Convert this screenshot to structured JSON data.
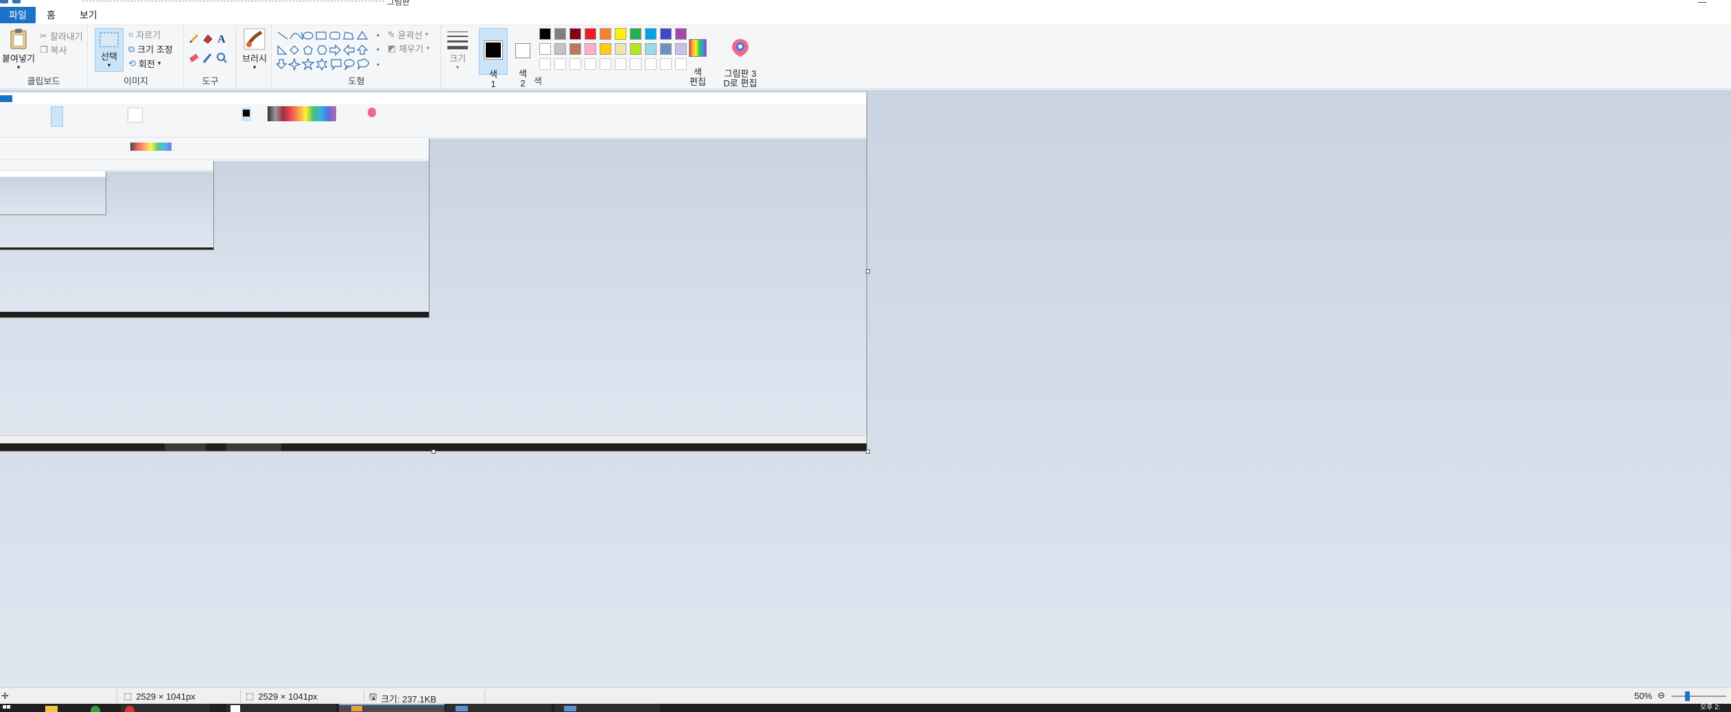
{
  "app": {
    "title": "그림판"
  },
  "menu": {
    "file": "파일",
    "home": "홈",
    "view": "보기"
  },
  "ribbon": {
    "clipboard": {
      "label": "클립보드",
      "paste": "붙여넣기",
      "cut": "잘라내기",
      "copy": "복사"
    },
    "image": {
      "label": "이미지",
      "select": "선택",
      "crop": "자르기",
      "resize": "크기 조정",
      "rotate": "회전"
    },
    "tools": {
      "label": "도구"
    },
    "brush": {
      "label": "브러시"
    },
    "shapes": {
      "label": "도형",
      "outline": "윤곽선",
      "fill": "채우기"
    },
    "size": {
      "label": "크기"
    },
    "colors": {
      "label": "색",
      "color1": "색\n1",
      "color2": "색\n2",
      "edit": "색\n편집",
      "paint3d": "그림판 3\nD로 편집",
      "row1": [
        "#000000",
        "#7f7f7f",
        "#880015",
        "#ed1c24",
        "#ff7f27",
        "#fff200",
        "#22b14c",
        "#00a2e8",
        "#3f48cc",
        "#a349a4"
      ],
      "row2": [
        "#ffffff",
        "#c3c3c3",
        "#b97a57",
        "#ffaec9",
        "#ffc90e",
        "#efe4b0",
        "#b5e61d",
        "#99d9ea",
        "#7092be",
        "#c8bfe7"
      ]
    }
  },
  "statusbar": {
    "selection_size": "2529 × 1041px",
    "image_size": "2529 × 1041px",
    "file_size": "크기: 237.1KB",
    "zoom": "50%"
  },
  "taskbar": {
    "clock": "오후 2:"
  }
}
